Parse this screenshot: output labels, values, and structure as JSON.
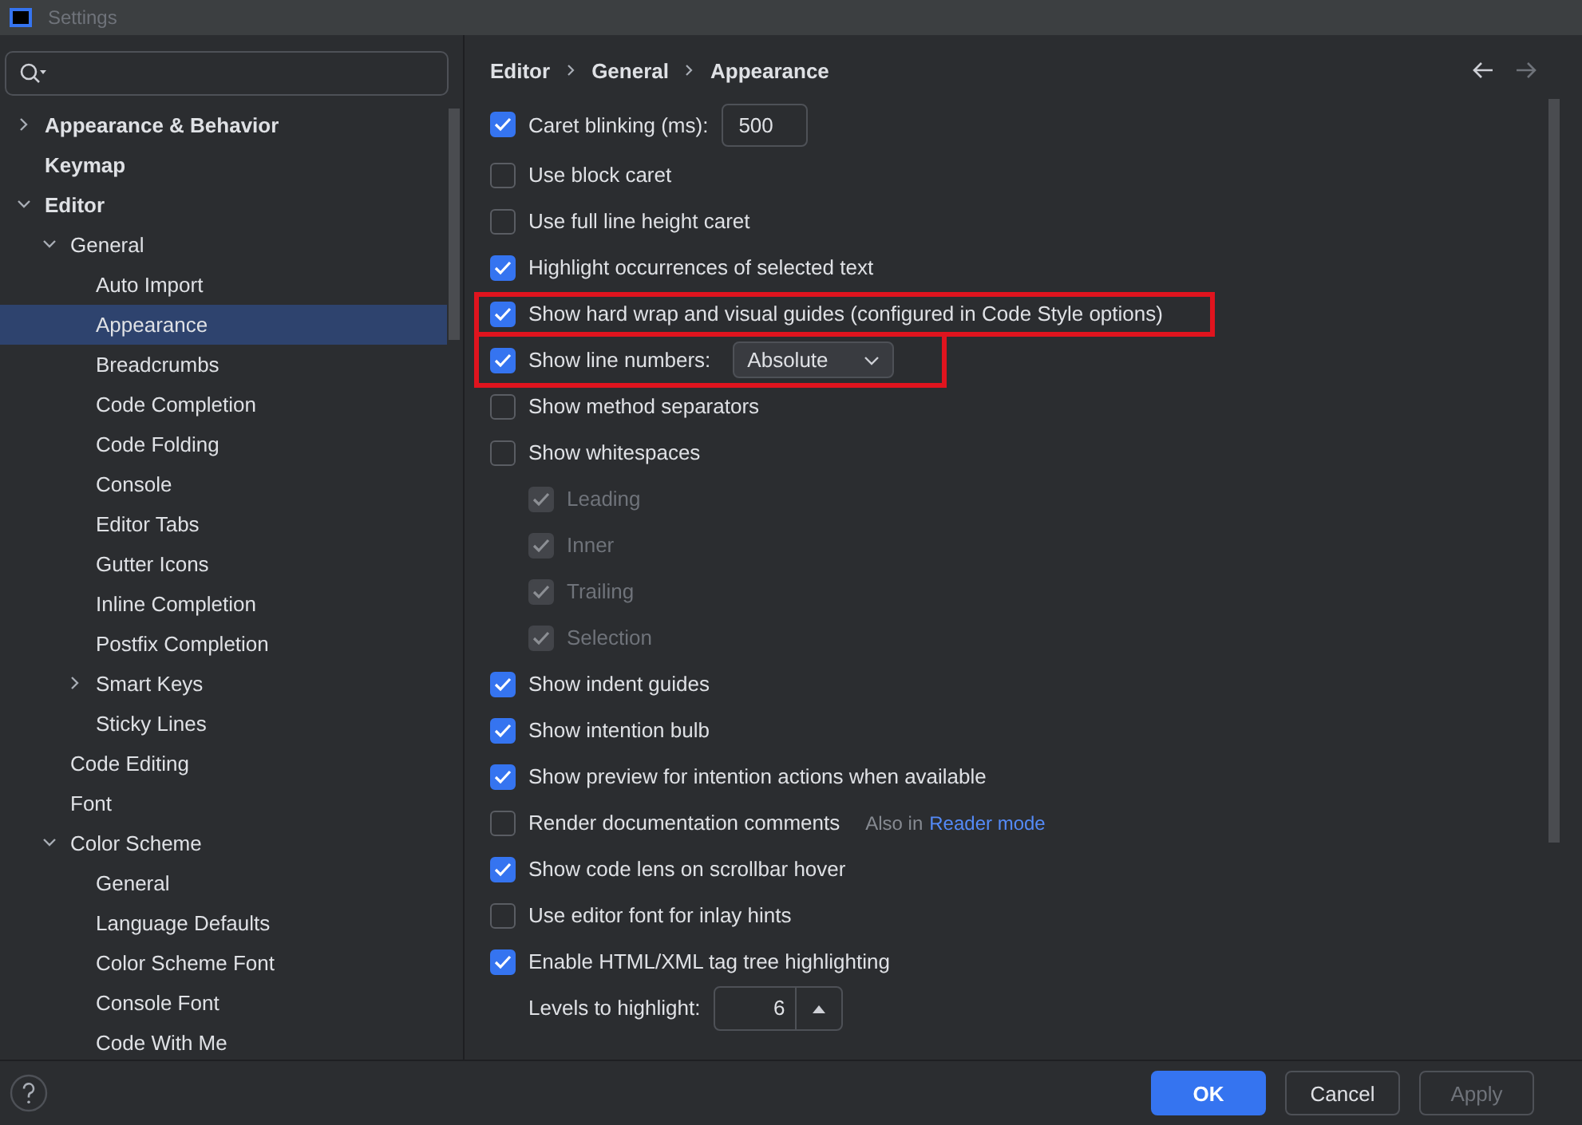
{
  "window": {
    "title": "Settings"
  },
  "sidebar": {
    "items": [
      {
        "label": "Appearance & Behavior",
        "selected": false,
        "expanded": false
      },
      {
        "label": "Keymap",
        "selected": false
      },
      {
        "label": "Editor",
        "selected": false,
        "expanded": true,
        "children": [
          {
            "label": "General",
            "selected": false,
            "expanded": true,
            "children": [
              {
                "label": "Auto Import",
                "selected": false
              },
              {
                "label": "Appearance",
                "selected": true
              },
              {
                "label": "Breadcrumbs",
                "selected": false
              },
              {
                "label": "Code Completion",
                "selected": false
              },
              {
                "label": "Code Folding",
                "selected": false
              },
              {
                "label": "Console",
                "selected": false
              },
              {
                "label": "Editor Tabs",
                "selected": false
              },
              {
                "label": "Gutter Icons",
                "selected": false
              },
              {
                "label": "Inline Completion",
                "selected": false
              },
              {
                "label": "Postfix Completion",
                "selected": false
              },
              {
                "label": "Smart Keys",
                "selected": false,
                "expanded": false
              },
              {
                "label": "Sticky Lines",
                "selected": false
              }
            ]
          },
          {
            "label": "Code Editing",
            "selected": false
          },
          {
            "label": "Font",
            "selected": false
          },
          {
            "label": "Color Scheme",
            "selected": false,
            "expanded": true,
            "children": [
              {
                "label": "General",
                "selected": false
              },
              {
                "label": "Language Defaults",
                "selected": false
              },
              {
                "label": "Color Scheme Font",
                "selected": false
              },
              {
                "label": "Console Font",
                "selected": false
              },
              {
                "label": "Code With Me",
                "selected": false
              }
            ]
          }
        ]
      }
    ]
  },
  "breadcrumb": [
    "Editor",
    "General",
    "Appearance"
  ],
  "options": [
    {
      "kind": "checkbox",
      "label": "Caret blinking (ms):",
      "checked": true,
      "value": "500"
    },
    {
      "kind": "checkbox",
      "label": "Use block caret",
      "checked": false
    },
    {
      "kind": "checkbox",
      "label": "Use full line height caret",
      "checked": false
    },
    {
      "kind": "checkbox",
      "label": "Highlight occurrences of selected text",
      "checked": true
    },
    {
      "kind": "checkbox",
      "label": "Show hard wrap and visual guides (configured in Code Style options)",
      "checked": true,
      "highlighted": true
    },
    {
      "kind": "checkbox",
      "label": "Show line numbers:",
      "checked": true,
      "dropdown": "Absolute",
      "highlighted": true
    },
    {
      "kind": "checkbox",
      "label": "Show method separators",
      "checked": false
    },
    {
      "kind": "checkbox",
      "label": "Show whitespaces",
      "checked": false,
      "children": [
        {
          "kind": "checkbox",
          "label": "Leading",
          "checked": true,
          "disabled": true
        },
        {
          "kind": "checkbox",
          "label": "Inner",
          "checked": true,
          "disabled": true
        },
        {
          "kind": "checkbox",
          "label": "Trailing",
          "checked": true,
          "disabled": true
        },
        {
          "kind": "checkbox",
          "label": "Selection",
          "checked": true,
          "disabled": true
        }
      ]
    },
    {
      "kind": "checkbox",
      "label": "Show indent guides",
      "checked": true
    },
    {
      "kind": "checkbox",
      "label": "Show intention bulb",
      "checked": true
    },
    {
      "kind": "checkbox",
      "label": "Show preview for intention actions when available",
      "checked": true
    },
    {
      "kind": "checkbox",
      "label": "Render documentation comments",
      "checked": false,
      "hint": "Also in",
      "link": "Reader mode"
    },
    {
      "kind": "checkbox",
      "label": "Show code lens on scrollbar hover",
      "checked": true
    },
    {
      "kind": "checkbox",
      "label": "Use editor font for inlay hints",
      "checked": false
    },
    {
      "kind": "checkbox",
      "label": "Enable HTML/XML tag tree highlighting",
      "checked": true,
      "children": [
        {
          "kind": "spinner",
          "label": "Levels to highlight:",
          "value": "6"
        }
      ]
    }
  ],
  "buttons": [
    {
      "label": "OK",
      "kind": "primary"
    },
    {
      "label": "Cancel",
      "kind": "secondary"
    },
    {
      "label": "Apply",
      "kind": "secondary",
      "disabled": true
    }
  ]
}
